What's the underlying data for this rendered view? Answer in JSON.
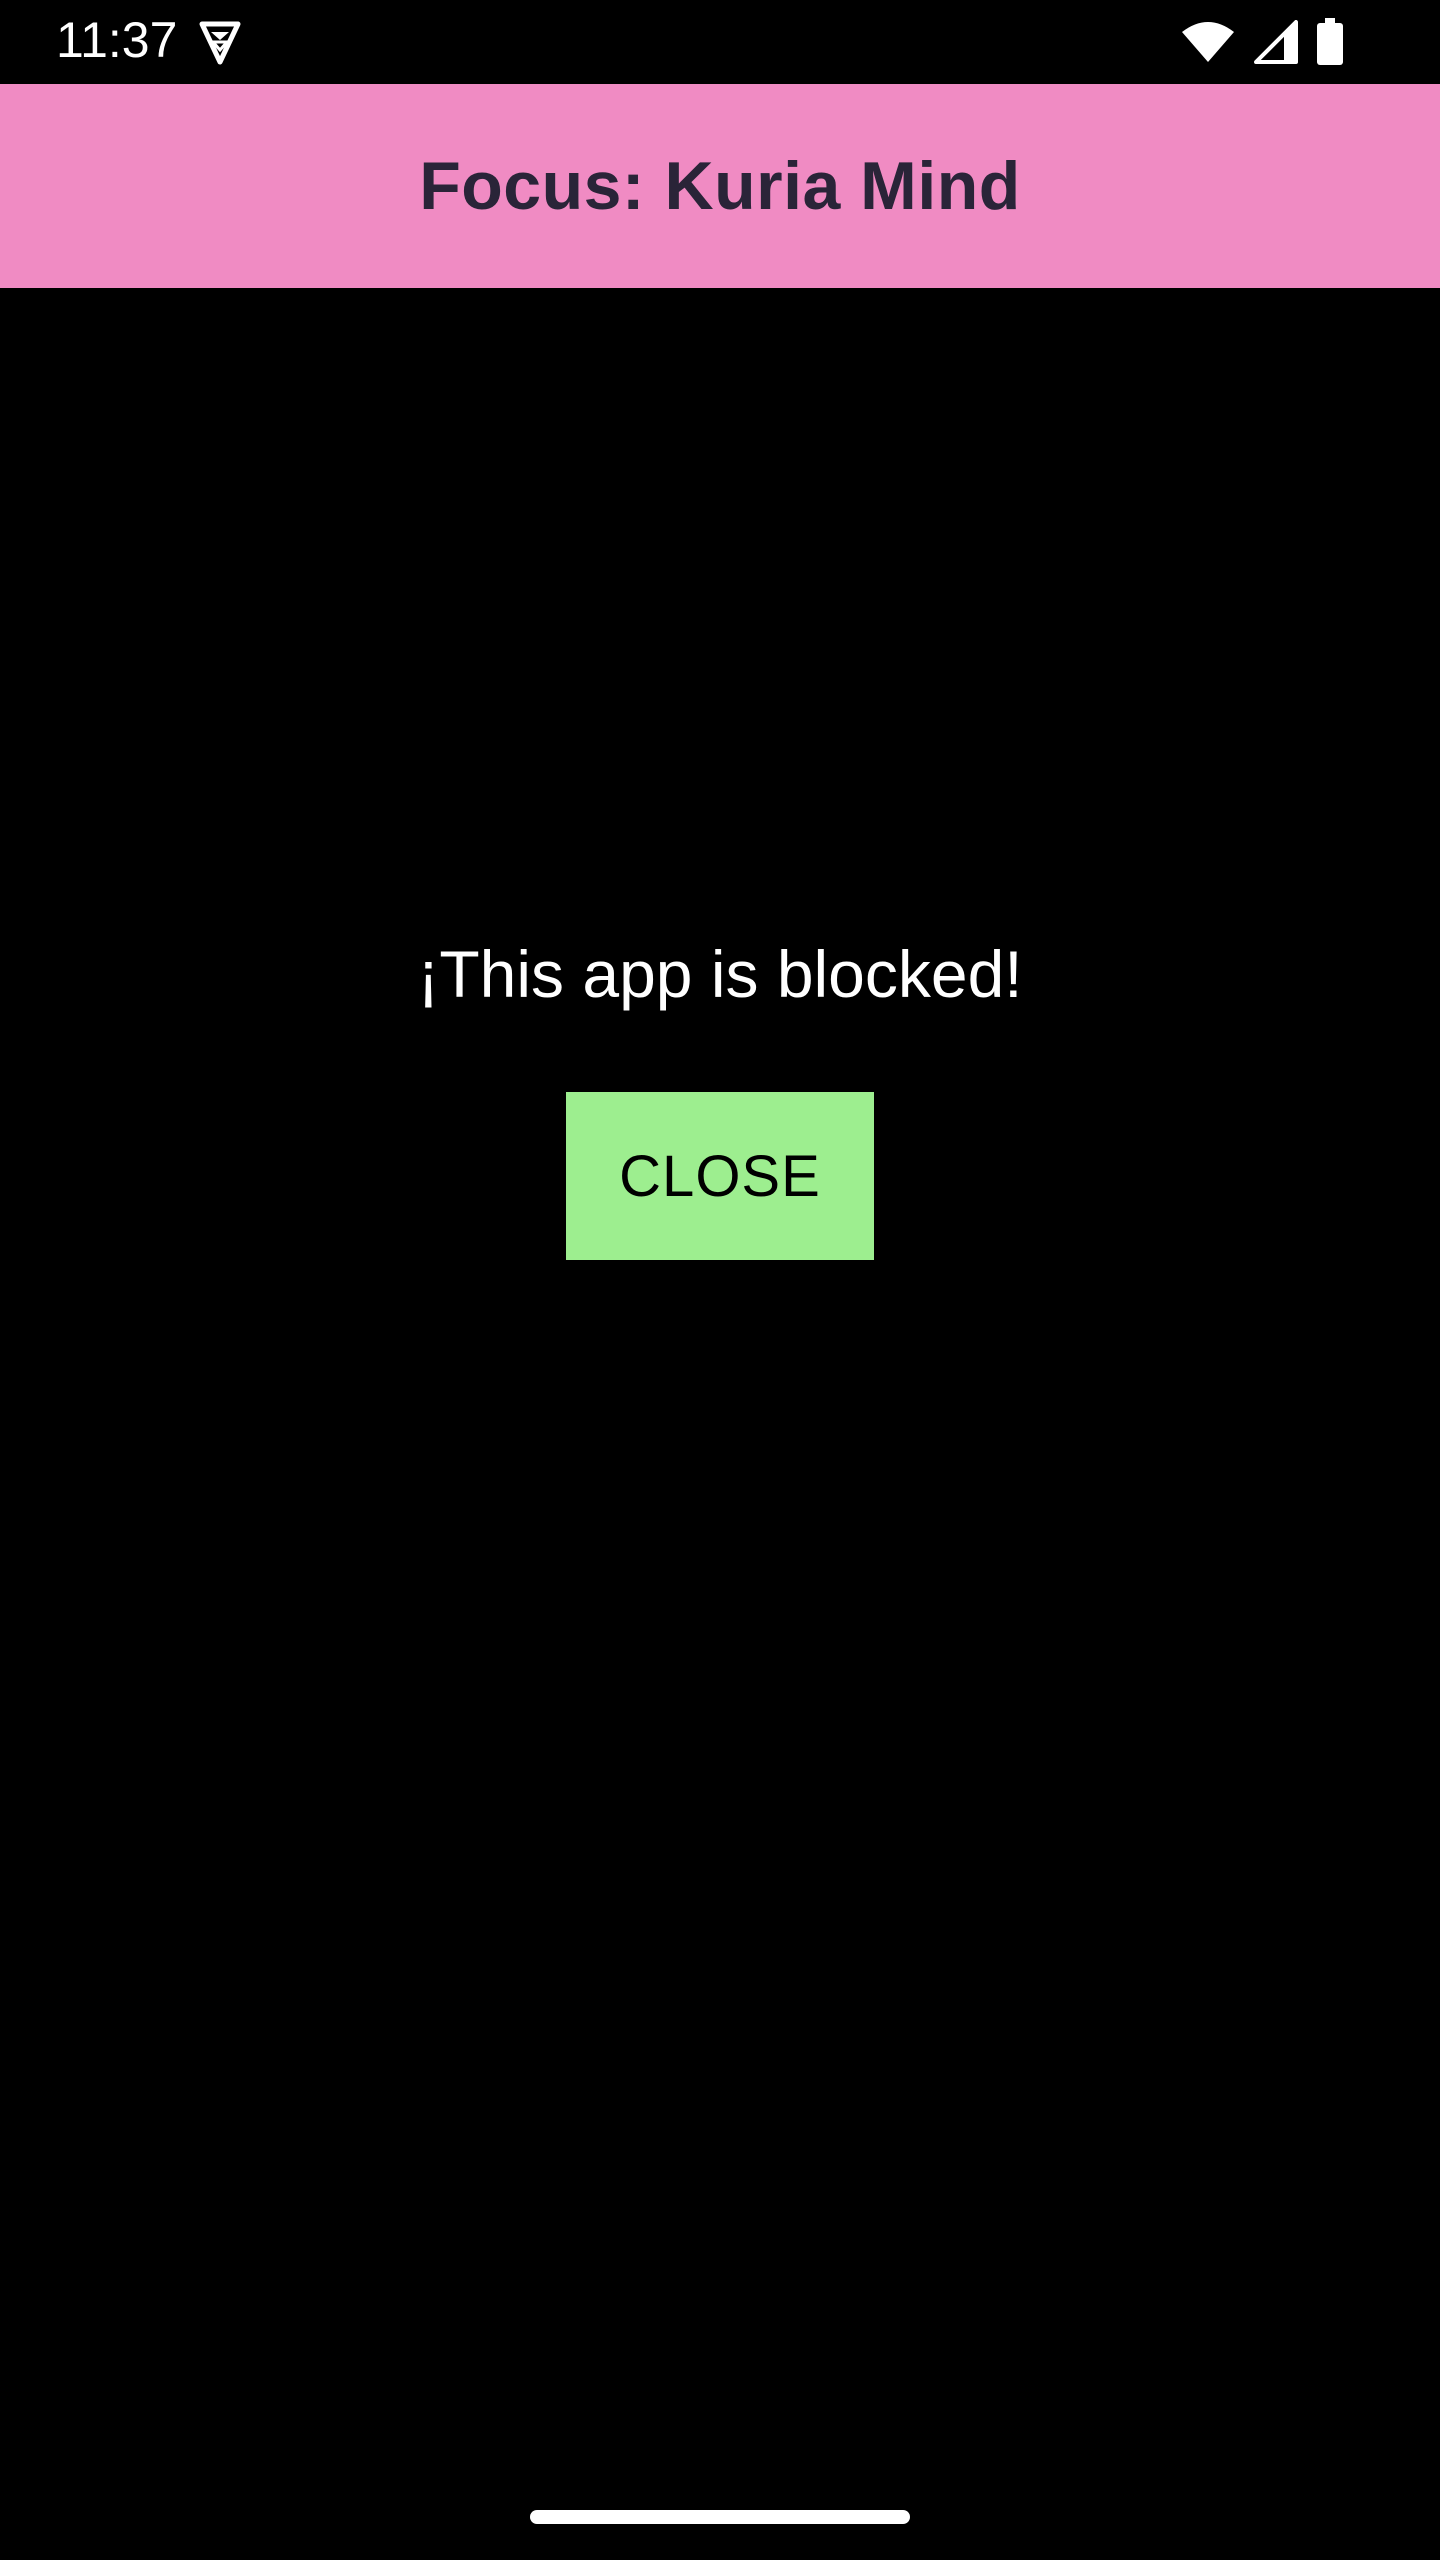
{
  "status_bar": {
    "time": "11:37",
    "left_icon": "shield-icon",
    "right_icons": [
      "wifi-icon",
      "cellular-signal-icon",
      "battery-icon"
    ]
  },
  "app_bar": {
    "title": "Focus: Kuria Mind",
    "background_color": "#f08bc3",
    "title_color": "#2a2438"
  },
  "main": {
    "message": "¡This app is blocked!",
    "close_button_label": "CLOSE",
    "close_button_color": "#9dee8f",
    "background_color": "#000000"
  },
  "nav": {
    "gesture_handle": "home-gesture-handle"
  }
}
